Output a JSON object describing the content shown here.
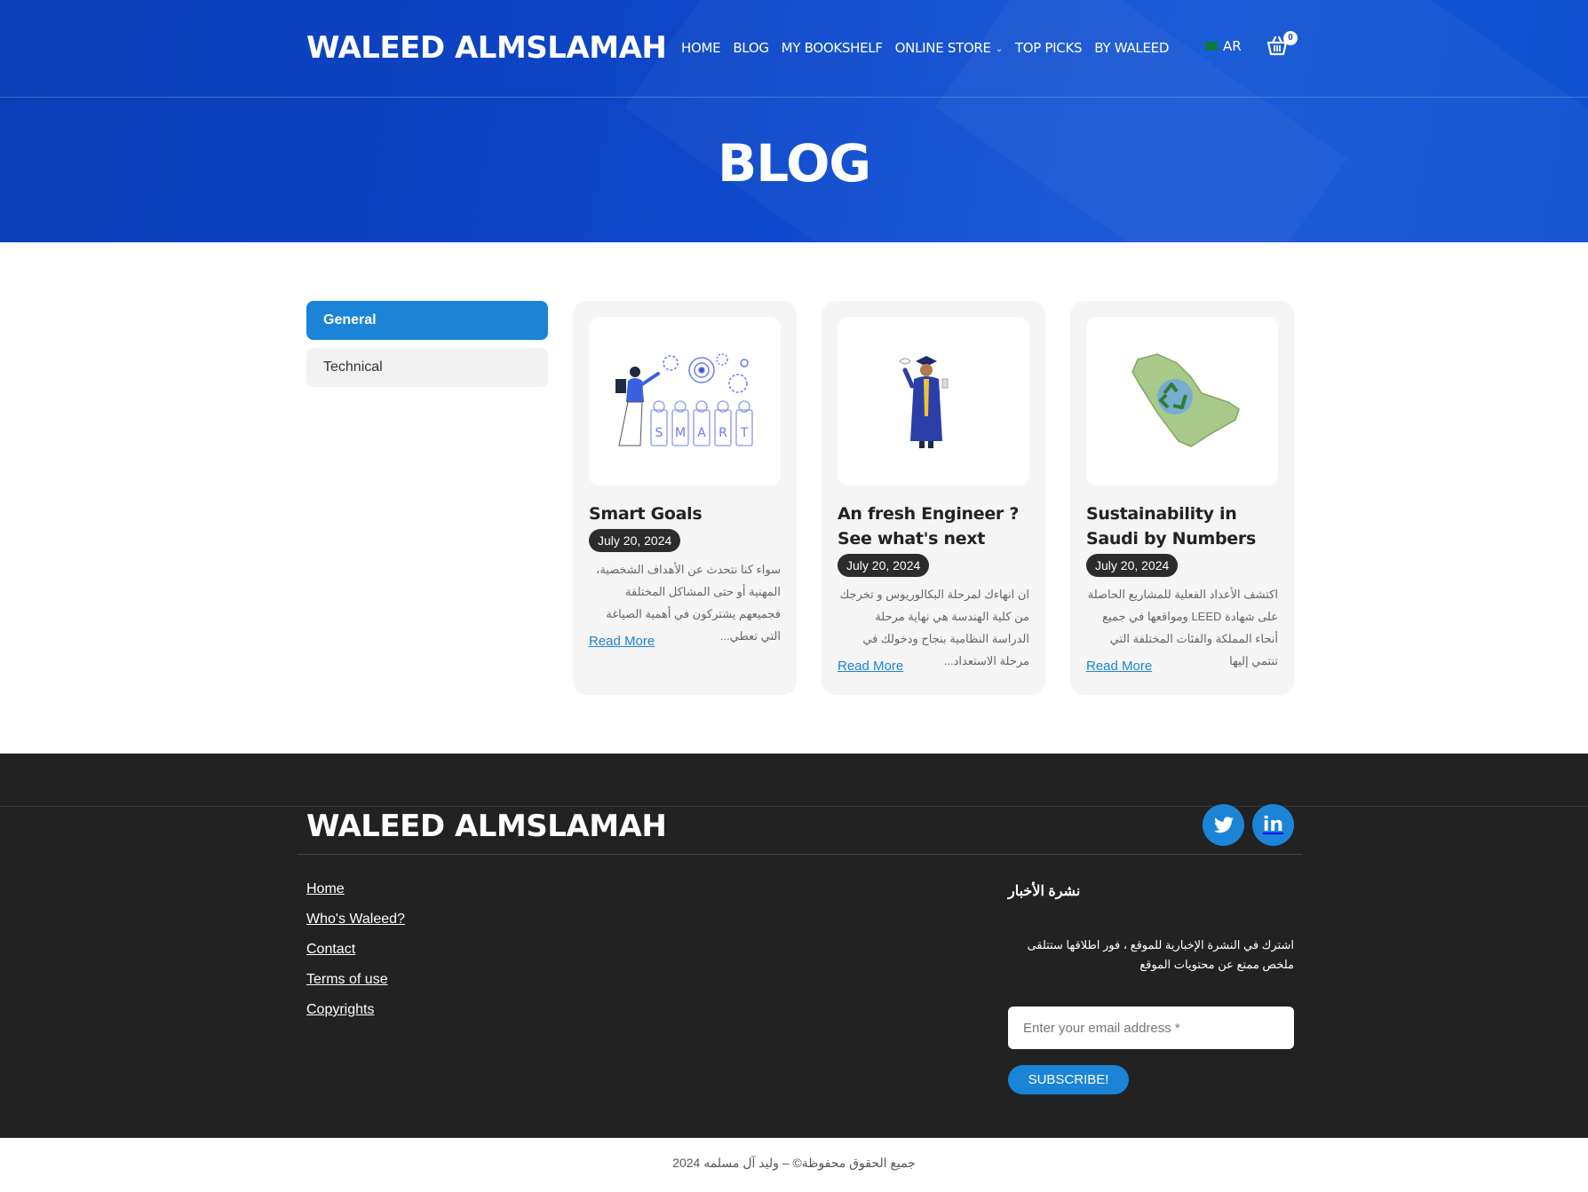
{
  "header": {
    "brand": "WALEED ALMSLAMAH",
    "nav": [
      {
        "label": "HOME"
      },
      {
        "label": "BLOG"
      },
      {
        "label": "MY BOOKSHELF"
      },
      {
        "label": "ONLINE STORE"
      },
      {
        "label": "TOP PICKS"
      },
      {
        "label": "BY WALEED"
      }
    ],
    "language": "AR",
    "cart_count": "0",
    "page_title": "BLOG"
  },
  "sidebar": {
    "categories": [
      {
        "label": "General",
        "active": true
      },
      {
        "label": "Technical",
        "active": false
      }
    ]
  },
  "posts": [
    {
      "title": "Smart Goals",
      "date": "July 20, 2024",
      "excerpt": "سواء كنا نتحدث عن الأهداف الشخصية، المهنية أو حتى المشاكل المختلفة فجميعهم يشتركون في أهمية الصياغة التي تعطي...",
      "read_more": "Read More",
      "image_icon": "smart-goals-illustration",
      "image_letters": [
        "S",
        "M",
        "A",
        "R",
        "T"
      ]
    },
    {
      "title": "An fresh Engineer ? See what's next",
      "date": "July 20, 2024",
      "excerpt": "ان انهاءك لمرحلة البكالوريوس و تخرجك من كلية الهندسة هي نهاية مرحلة الدراسة النظامية بنجاح ودخولك في مرحلة الاستعداد...",
      "read_more": "Read More",
      "image_icon": "graduate-illustration"
    },
    {
      "title": "Sustainability in Saudi by Numbers",
      "date": "July 20, 2024",
      "excerpt": "اكتشف الأعداد الفعلية للمشاريع الحاصلة على شهادة LEED ومواقعها في جميع أنحاء المملكة والفئات المختلفة التي تنتمي إليها",
      "read_more": "Read More",
      "image_icon": "saudi-map-recycle-illustration"
    }
  ],
  "footer": {
    "brand": "WALEED ALMSLAMAH",
    "links": [
      {
        "label": "Home"
      },
      {
        "label": "Who's Waleed?"
      },
      {
        "label": "Contact"
      },
      {
        "label": "Terms of use"
      },
      {
        "label": "Copyrights"
      }
    ],
    "social": [
      {
        "name": "twitter-icon"
      },
      {
        "name": "linkedin-icon",
        "glyph": "in"
      }
    ],
    "newsletter": {
      "title": "نشرة الأخبار",
      "description": "اشترك في النشرة الإخبارية للموقع ، فور اطلاقها ستتلقى ملخص ممتع عن محتويات الموقع",
      "email_placeholder": "Enter your email address *",
      "button": "SUBSCRIBE!"
    }
  },
  "copyright": "جميع الحقوق محفوظة© – وليد آل مسلمه 2024",
  "colors": {
    "header_blue": "#0d44c4",
    "accent": "#1b84d6",
    "footer_bg": "#222222",
    "card_bg": "#f5f5f5"
  }
}
